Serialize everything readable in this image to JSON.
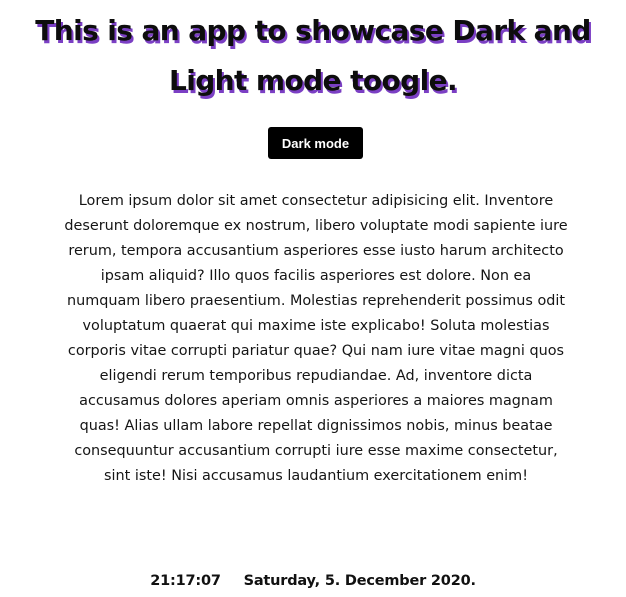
{
  "header": {
    "title": "This is an app to showcase Dark and Light mode toogle."
  },
  "toggle": {
    "label": "Dark mode"
  },
  "content": {
    "paragraph": "Lorem ipsum dolor sit amet consectetur adipisicing elit. Inventore deserunt doloremque ex nostrum, libero voluptate modi sapiente iure rerum, tempora accusantium asperiores esse iusto harum architecto ipsam aliquid? Illo quos facilis asperiores est dolore. Non ea numquam libero praesentium. Molestias reprehenderit possimus odit voluptatum quaerat qui maxime iste explicabo! Soluta molestias corporis vitae corrupti pariatur quae? Qui nam iure vitae magni quos eligendi rerum temporibus repudiandae. Ad, inventore dicta accusamus dolores aperiam omnis asperiores a maiores magnam quas! Alias ullam labore repellat dignissimos nobis, minus beatae consequuntur accusantium corrupti iure esse maxime consectetur, sint iste! Nisi accusamus laudantium exercitationem enim!"
  },
  "footer": {
    "time": "21:17:07",
    "date": "Saturday, 5. December 2020."
  },
  "colors": {
    "title_shadow": "#7b3fc4",
    "button_background": "#000000",
    "button_text": "#ffffff",
    "page_background": "#ffffff"
  }
}
